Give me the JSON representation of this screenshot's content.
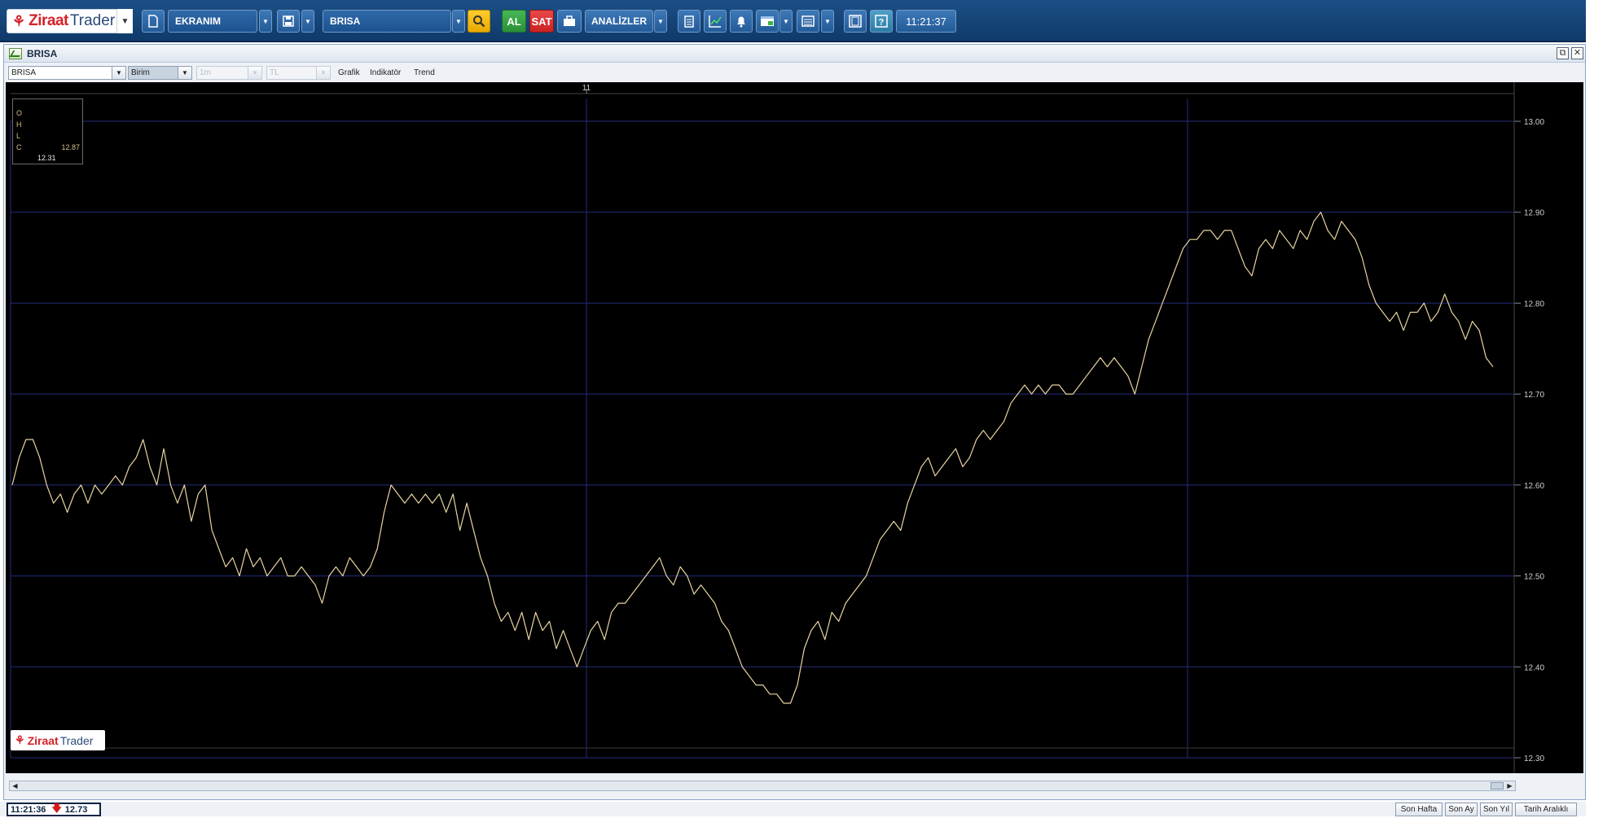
{
  "app": {
    "logo_ziraat": "Ziraat",
    "logo_trader": "Trader"
  },
  "toolbar": {
    "screen_label": "EKRANIM",
    "symbol_value": "BRISA",
    "buy_label": "AL",
    "sell_label": "SAT",
    "analyses_label": "ANALİZLER",
    "clock": "11:21:37"
  },
  "window": {
    "title": "BRISA",
    "symbol_combo": "BRISA",
    "unit_combo": "Birim",
    "period_combo": "1m",
    "currency_combo": "TL",
    "menu": [
      "Grafik",
      "Indikatör",
      "Trend"
    ]
  },
  "ohlc": {
    "labels": [
      "O",
      "H",
      "L",
      "C"
    ],
    "close_value": "12.87",
    "extra_value": "12.31"
  },
  "chart_data": {
    "type": "line",
    "top_label": "11",
    "y_ticks": [
      "13.00",
      "12.90",
      "12.80",
      "12.70",
      "12.60",
      "12.50",
      "12.40",
      "12.30"
    ],
    "ylim": [
      12.3,
      13.0
    ],
    "colors": {
      "background": "#000000",
      "series": "#e8d4a0",
      "grid": "#232c7a"
    },
    "series": [
      {
        "values": [
          12.6,
          12.63,
          12.65,
          12.65,
          12.63,
          12.6,
          12.58,
          12.59,
          12.57,
          12.59,
          12.6,
          12.58,
          12.6,
          12.59,
          12.6,
          12.61,
          12.6,
          12.62,
          12.63,
          12.65,
          12.62,
          12.6,
          12.64,
          12.6,
          12.58,
          12.6,
          12.56,
          12.59,
          12.6,
          12.55,
          12.53,
          12.51,
          12.52,
          12.5,
          12.53,
          12.51,
          12.52,
          12.5,
          12.51,
          12.52,
          12.5,
          12.5,
          12.51,
          12.5,
          12.49,
          12.47,
          12.5,
          12.51,
          12.5,
          12.52,
          12.51,
          12.5,
          12.51,
          12.53,
          12.57,
          12.6,
          12.59,
          12.58,
          12.59,
          12.58,
          12.59,
          12.58,
          12.59,
          12.57,
          12.59,
          12.55,
          12.58,
          12.55,
          12.52,
          12.5,
          12.47,
          12.45,
          12.46,
          12.44,
          12.46,
          12.43,
          12.46,
          12.44,
          12.45,
          12.42,
          12.44,
          12.42,
          12.4,
          12.42,
          12.44,
          12.45,
          12.43,
          12.46,
          12.47,
          12.47,
          12.48,
          12.49,
          12.5,
          12.51,
          12.52,
          12.5,
          12.49,
          12.51,
          12.5,
          12.48,
          12.49,
          12.48,
          12.47,
          12.45,
          12.44,
          12.42,
          12.4,
          12.39,
          12.38,
          12.38,
          12.37,
          12.37,
          12.36,
          12.36,
          12.38,
          12.42,
          12.44,
          12.45,
          12.43,
          12.46,
          12.45,
          12.47,
          12.48,
          12.49,
          12.5,
          12.52,
          12.54,
          12.55,
          12.56,
          12.55,
          12.58,
          12.6,
          12.62,
          12.63,
          12.61,
          12.62,
          12.63,
          12.64,
          12.62,
          12.63,
          12.65,
          12.66,
          12.65,
          12.66,
          12.67,
          12.69,
          12.7,
          12.71,
          12.7,
          12.71,
          12.7,
          12.71,
          12.71,
          12.7,
          12.7,
          12.71,
          12.72,
          12.73,
          12.74,
          12.73,
          12.74,
          12.73,
          12.72,
          12.7,
          12.73,
          12.76,
          12.78,
          12.8,
          12.82,
          12.84,
          12.86,
          12.87,
          12.87,
          12.88,
          12.88,
          12.87,
          12.88,
          12.88,
          12.86,
          12.84,
          12.83,
          12.86,
          12.87,
          12.86,
          12.88,
          12.87,
          12.86,
          12.88,
          12.87,
          12.89,
          12.9,
          12.88,
          12.87,
          12.89,
          12.88,
          12.87,
          12.85,
          12.82,
          12.8,
          12.79,
          12.78,
          12.79,
          12.77,
          12.79,
          12.79,
          12.8,
          12.78,
          12.79,
          12.81,
          12.79,
          12.78,
          12.76,
          12.78,
          12.77,
          12.74,
          12.73
        ]
      }
    ]
  },
  "statusbar": {
    "time": "11:21:36",
    "last_price": "12.73",
    "ranges": [
      "Son Hafta",
      "Son Ay",
      "Son Yıl",
      "Tarih Aralıklı"
    ]
  }
}
